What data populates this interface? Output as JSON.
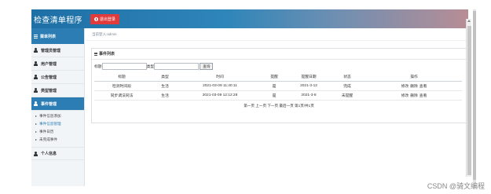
{
  "app": {
    "title": "检查清单程序",
    "logout_label": "退出登录"
  },
  "sidebar": {
    "header": "菜单列表",
    "items": [
      {
        "label": "管理员管理"
      },
      {
        "label": "用户管理"
      },
      {
        "label": "公告管理"
      },
      {
        "label": "类型管理"
      },
      {
        "label": "事件管理"
      }
    ],
    "sub_items": [
      {
        "label": "事件信息添加"
      },
      {
        "label": "事件信息管理"
      },
      {
        "label": "事件日历"
      },
      {
        "label": "未完成事件"
      }
    ],
    "personal": {
      "label": "个人信息"
    }
  },
  "breadcrumb": "当前登入:admin",
  "panel": {
    "title": "事件列表",
    "search": {
      "title_label": "标题",
      "title_value": "",
      "type_label": "类型",
      "type_value": "",
      "button": "查询"
    },
    "columns": [
      "标题",
      "类型",
      "时间",
      "提醒",
      "提醒日期",
      "状态",
      "操作"
    ],
    "rows": [
      {
        "title": "检测时间段",
        "type": "生活",
        "time": "2021-03-09 11:40:11",
        "remind": "是",
        "remind_date": "2021-3-12",
        "status": "完成",
        "ops": [
          "修改",
          "删除",
          "查看"
        ]
      },
      {
        "title": "同步调法同法",
        "type": "生活",
        "time": "2021-03-09 12:12:28",
        "remind": "是",
        "remind_date": "2021-3-8",
        "status": "未提醒",
        "ops": [
          "修改",
          "删除",
          "查看"
        ]
      }
    ],
    "pager": "第一页 上一页 下一页 最后一页 第1页/共1页"
  },
  "watermark": "CSDN @骑文编程",
  "colors": {
    "topbar": "#1d6fa5",
    "accent": "#2b7db4",
    "logout": "#e23b3b"
  }
}
